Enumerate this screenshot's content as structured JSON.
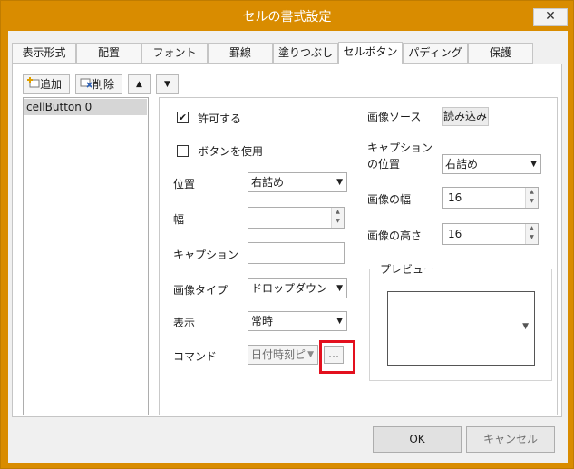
{
  "window": {
    "title": "セルの書式設定",
    "close_glyph": "✕"
  },
  "tabs": [
    {
      "label": "表示形式"
    },
    {
      "label": "配置"
    },
    {
      "label": "フォント"
    },
    {
      "label": "罫線"
    },
    {
      "label": "塗りつぶし"
    },
    {
      "label": "セルボタン"
    },
    {
      "label": "パディング"
    },
    {
      "label": "保護"
    }
  ],
  "toolbar": {
    "add_label": "追加",
    "delete_label": "削除",
    "up_glyph": "▲",
    "down_glyph": "▼"
  },
  "list": {
    "items": [
      "cellButton 0"
    ]
  },
  "props": {
    "allow_label": "許可する",
    "allow_checked": "✔",
    "use_button_label": "ボタンを使用",
    "position_label": "位置",
    "position_value": "右詰め",
    "width_label": "幅",
    "caption_label": "キャプション",
    "image_type_label": "画像タイプ",
    "image_type_value": "ドロップダウン",
    "display_label": "表示",
    "display_value": "常時",
    "command_label": "コマンド",
    "command_value": "日付時刻ピ",
    "command_more": "…",
    "image_source_label": "画像ソース",
    "load_label": "読み込み",
    "caption_position_label_1": "キャプション",
    "caption_position_label_2": "の位置",
    "caption_position_value": "右詰め",
    "image_width_label": "画像の幅",
    "image_width_value": "16",
    "image_height_label": "画像の高さ",
    "image_height_value": "16",
    "preview_label": "プレビュー",
    "preview_arrow": "▼"
  },
  "footer": {
    "ok_label": "OK",
    "cancel_label": "キャンセル"
  },
  "colors": {
    "titlebar": "#d98c00",
    "highlight": "#e3101e"
  }
}
